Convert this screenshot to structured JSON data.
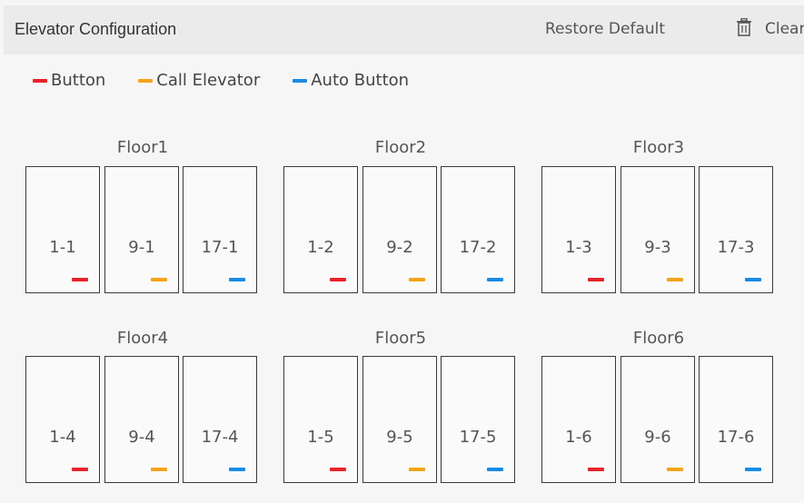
{
  "header": {
    "title": "Elevator Configuration",
    "restore_label": "Restore Default",
    "clear_label": "Clear"
  },
  "legend": [
    {
      "label": "Button",
      "color": "#e8232b"
    },
    {
      "label": "Call Elevator",
      "color": "#f5a31a"
    },
    {
      "label": "Auto Button",
      "color": "#1a8be3"
    }
  ],
  "floors": [
    {
      "label": "Floor1",
      "cells": [
        {
          "label": "1-1",
          "type": "button"
        },
        {
          "label": "9-1",
          "type": "call"
        },
        {
          "label": "17-1",
          "type": "auto"
        }
      ]
    },
    {
      "label": "Floor2",
      "cells": [
        {
          "label": "1-2",
          "type": "button"
        },
        {
          "label": "9-2",
          "type": "call"
        },
        {
          "label": "17-2",
          "type": "auto"
        }
      ]
    },
    {
      "label": "Floor3",
      "cells": [
        {
          "label": "1-3",
          "type": "button"
        },
        {
          "label": "9-3",
          "type": "call"
        },
        {
          "label": "17-3",
          "type": "auto"
        }
      ]
    },
    {
      "label": "Floor4",
      "cells": [
        {
          "label": "1-4",
          "type": "button"
        },
        {
          "label": "9-4",
          "type": "call"
        },
        {
          "label": "17-4",
          "type": "auto"
        }
      ]
    },
    {
      "label": "Floor5",
      "cells": [
        {
          "label": "1-5",
          "type": "button"
        },
        {
          "label": "9-5",
          "type": "call"
        },
        {
          "label": "17-5",
          "type": "auto"
        }
      ]
    },
    {
      "label": "Floor6",
      "cells": [
        {
          "label": "1-6",
          "type": "button"
        },
        {
          "label": "9-6",
          "type": "call"
        },
        {
          "label": "17-6",
          "type": "auto"
        }
      ]
    }
  ],
  "type_colors": {
    "button": "#e8232b",
    "call": "#f5a31a",
    "auto": "#1a8be3"
  }
}
